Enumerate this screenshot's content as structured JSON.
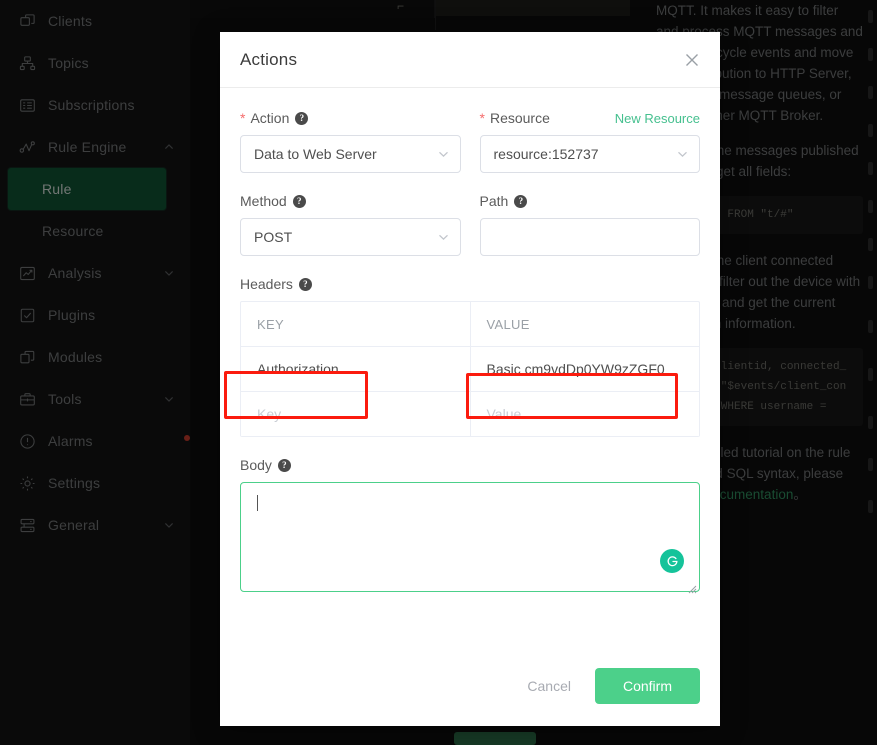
{
  "sidebar": {
    "items": [
      {
        "label": "Clients",
        "icon": "clients-icon",
        "caret": "",
        "active": false,
        "sub": false,
        "badge": false
      },
      {
        "label": "Topics",
        "icon": "topics-icon",
        "caret": "",
        "active": false,
        "sub": false,
        "badge": false
      },
      {
        "label": "Subscriptions",
        "icon": "subscriptions-icon",
        "caret": "",
        "active": false,
        "sub": false,
        "badge": false
      },
      {
        "label": "Rule Engine",
        "icon": "rule-engine-icon",
        "caret": "up",
        "active": false,
        "sub": false,
        "badge": false
      },
      {
        "label": "Rule",
        "icon": "",
        "caret": "",
        "active": true,
        "sub": true,
        "badge": false
      },
      {
        "label": "Resource",
        "icon": "",
        "caret": "",
        "active": false,
        "sub": true,
        "badge": false
      },
      {
        "label": "Analysis",
        "icon": "analysis-icon",
        "caret": "down",
        "active": false,
        "sub": false,
        "badge": false
      },
      {
        "label": "Plugins",
        "icon": "plugins-icon",
        "caret": "",
        "active": false,
        "sub": false,
        "badge": false
      },
      {
        "label": "Modules",
        "icon": "modules-icon",
        "caret": "",
        "active": false,
        "sub": false,
        "badge": false
      },
      {
        "label": "Tools",
        "icon": "tools-icon",
        "caret": "down",
        "active": false,
        "sub": false,
        "badge": false
      },
      {
        "label": "Alarms",
        "icon": "alarms-icon",
        "caret": "",
        "active": false,
        "sub": false,
        "badge": true
      },
      {
        "label": "Settings",
        "icon": "settings-icon",
        "caret": "",
        "active": false,
        "sub": false,
        "badge": false
      },
      {
        "label": "General",
        "icon": "general-icon",
        "caret": "down",
        "active": false,
        "sub": false,
        "badge": false
      }
    ]
  },
  "doc_panel": {
    "paragraphs": [
      "MQTT. It makes it easy to filter and process MQTT messages and device lifecycle events and move data distribution to HTTP Server, database, message queues, or even another MQTT Broker.",
      "To select the messages published to t/# and get all fields:"
    ],
    "code1": "SELECT * FROM \"t/#\"",
    "paragraph3": "To select the client connected event and filter out the device with Username and get the current connection information.",
    "code2": "SELECT clientid, connected_at FROM \"$events/client_connected\" WHERE username = ",
    "paragraph4_pre": "For a detailed tutorial on the rule engine and SQL syntax, please refer to ",
    "paragraph4_link": "Documentation",
    "paragraph4_post": "。"
  },
  "modal": {
    "title": "Actions",
    "close_icon": "close-icon",
    "action": {
      "label": "Action",
      "required_mark": "*",
      "help_icon": "help-icon",
      "value": "Data to Web Server",
      "chevron_icon": "chevron-down-icon"
    },
    "resource": {
      "label": "Resource",
      "required_mark": "*",
      "link_label": "New Resource",
      "value": "resource:152737",
      "chevron_icon": "chevron-down-icon"
    },
    "method": {
      "label": "Method",
      "help_icon": "help-icon",
      "value": "POST",
      "chevron_icon": "chevron-down-icon"
    },
    "path": {
      "label": "Path",
      "help_icon": "help-icon",
      "value": "",
      "placeholder": ""
    },
    "headers": {
      "label": "Headers",
      "help_icon": "help-icon",
      "columns": [
        "KEY",
        "VALUE"
      ],
      "rows": [
        {
          "key": "Authorization",
          "value": "Basic cm9vdDp0YW9zZGF0"
        }
      ],
      "blank_row": {
        "key_placeholder": "Key",
        "value_placeholder": "Value"
      }
    },
    "body": {
      "label": "Body",
      "help_icon": "help-icon",
      "value": "",
      "assistant_icon": "grammarly-icon",
      "resize_icon": "resize-handle-icon"
    },
    "footer": {
      "cancel_label": "Cancel",
      "confirm_label": "Confirm"
    }
  },
  "colors": {
    "accent_green": "#4cd08a",
    "sidebar_active": "#0f5132",
    "link_green": "#46c08f",
    "annotation_red": "#fb1b0e",
    "required_red": "#f56c6c"
  }
}
